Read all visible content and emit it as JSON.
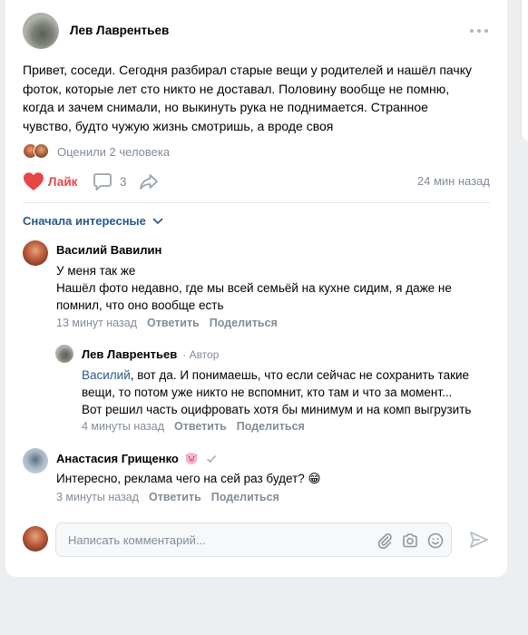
{
  "post": {
    "author": "Лев Лаврентьев",
    "text": "Привет, соседи. Сегодня разбирал старые вещи у родителей и нашёл пачку\nфоток, которые лет сто никто не доставал. Половину вообще не помню,\nкогда и зачем снимали, но выкинуть рука не поднимается. Странное\nчувство, будто чужую жизнь смотришь, а вроде своя",
    "rated_text": "Оценили 2 человека",
    "like_label": "Лайк",
    "comment_count": "3",
    "time": "24 мин назад"
  },
  "comments_header": {
    "sort_label": "Сначала интересные"
  },
  "comments": [
    {
      "name": "Василий Вавилин",
      "text": "У меня так же\nНашёл фото недавно, где мы всей семьёй на кухне сидим, я даже не\nпомнил, что оно вообще есть",
      "time": "13 минут назад",
      "reply": "Ответить",
      "share": "Поделиться"
    },
    {
      "name": "Лев Лаврентьев",
      "badge": "· Автор",
      "mention": "Василий",
      "text": ", вот да. И понимаешь, что если сейчас не сохранить такие\nвещи, то потом уже никто не вспомнит, кто там и что за момент...\nВот решил часть оцифровать хотя бы минимум и на комп выгрузить",
      "time": "4 минуты назад",
      "reply": "Ответить",
      "share": "Поделиться"
    },
    {
      "name": "Анастасия Грищенко",
      "text": "Интересно, реклама чего на сей раз будет? 😁",
      "time": "3 минуты назад",
      "reply": "Ответить",
      "share": "Поделиться"
    }
  ],
  "compose": {
    "placeholder": "Написать комментарий..."
  },
  "colors": {
    "accent_link": "#2a5885",
    "like_red": "#e64646",
    "meta_gray": "#818c99"
  },
  "icons": [
    "more-icon",
    "heart-icon",
    "comment-icon",
    "share-icon",
    "chevron-down-icon",
    "check-icon",
    "pig-emoji-icon",
    "paperclip-icon",
    "camera-icon",
    "smile-icon",
    "send-icon"
  ]
}
